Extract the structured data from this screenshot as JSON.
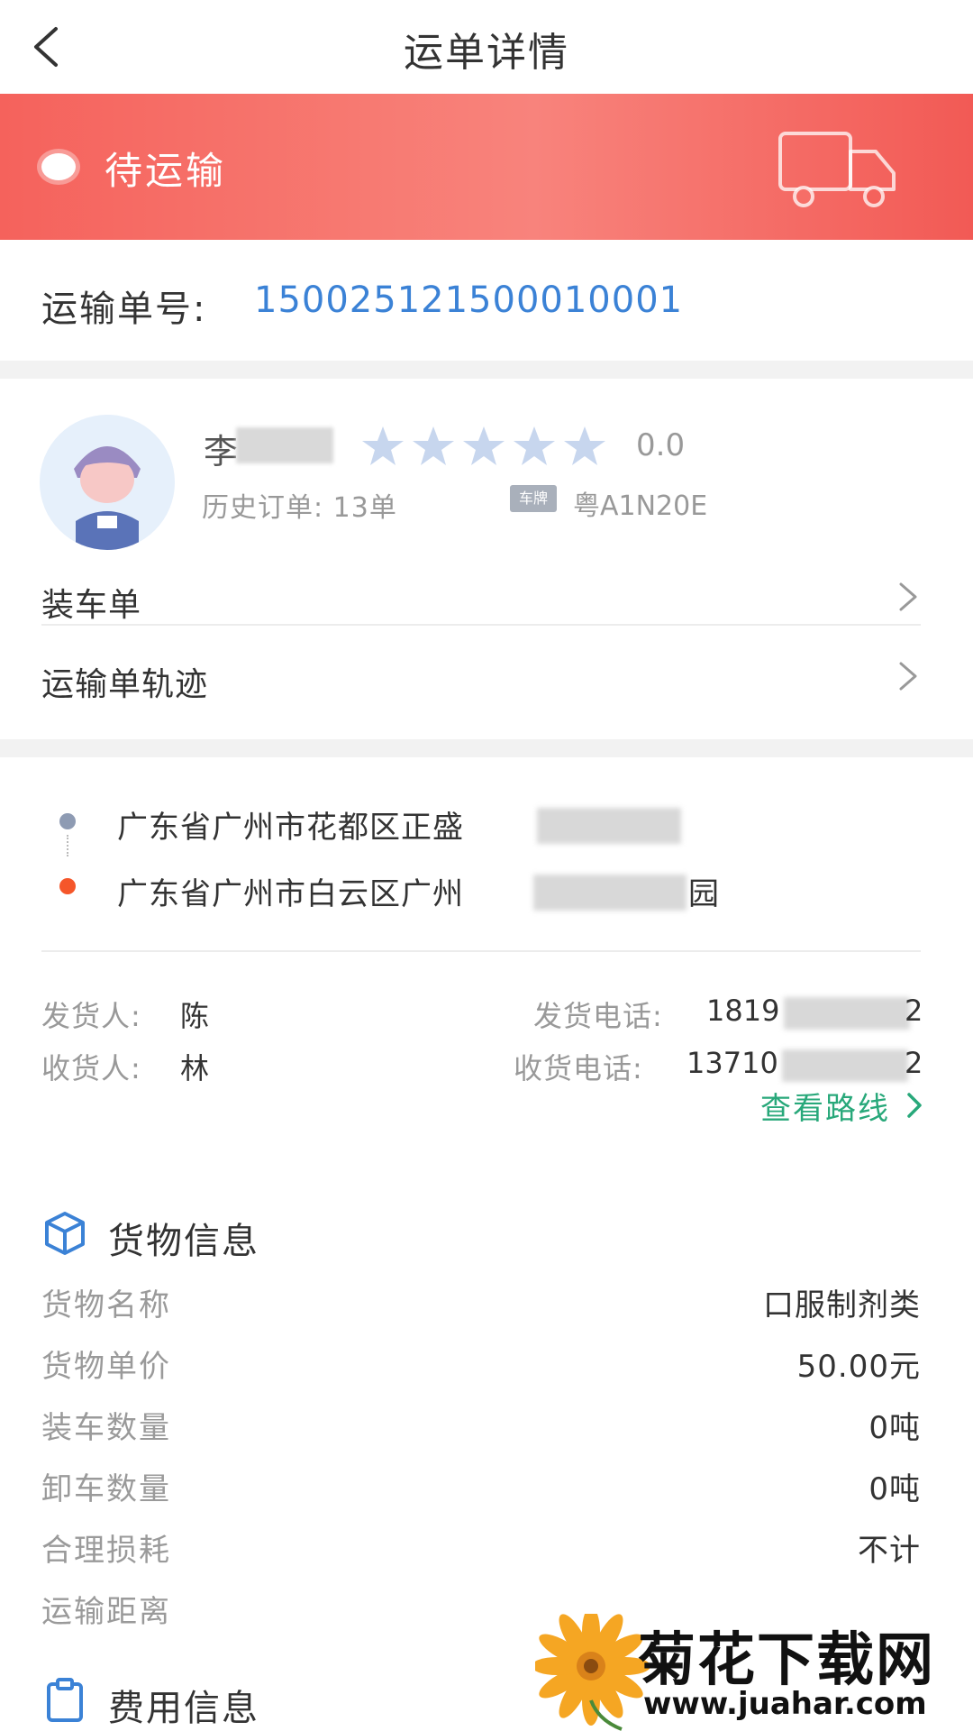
{
  "header": {
    "back_icon": "chevron-left-icon",
    "title": "运单详情"
  },
  "status": {
    "label": "待运输",
    "icon": "truck-icon",
    "gradient": [
      "#f5625c",
      "#f8837c",
      "#f25a55"
    ]
  },
  "waybill": {
    "label": "运输单号:",
    "number": "150025121500010001"
  },
  "driver": {
    "name_first": "李",
    "rating_stars": 0,
    "rating_max": 5,
    "rating_text": "0.0",
    "history_orders": "历史订单: 13单",
    "plate_tag": "车牌",
    "plate_number": "粤A1N20E"
  },
  "menu": {
    "items": [
      {
        "label": "装车单"
      },
      {
        "label": "运输单轨迹"
      }
    ]
  },
  "route": {
    "from_address": "广东省广州市花都区正盛",
    "to_address": "广东省广州市白云区广州",
    "to_suffix": "园",
    "shipper_label": "发货人:",
    "shipper_name": "陈",
    "shipper_phone_label": "发货电话:",
    "shipper_phone_head": "1819",
    "shipper_phone_tail": "2",
    "receiver_label": "收货人:",
    "receiver_name": "林",
    "receiver_phone_label": "收货电话:",
    "receiver_phone_head": "13710",
    "receiver_phone_tail": "2",
    "view_route": "查看路线"
  },
  "cargo": {
    "title": "货物信息",
    "rows": [
      {
        "label": "货物名称",
        "value": "口服制剂类"
      },
      {
        "label": "货物单价",
        "value": "50.00元"
      },
      {
        "label": "装车数量",
        "value": "0吨"
      },
      {
        "label": "卸车数量",
        "value": "0吨"
      },
      {
        "label": "合理损耗",
        "value": "不计"
      },
      {
        "label": "运输距离",
        "value": ""
      }
    ]
  },
  "fee": {
    "title": "费用信息"
  },
  "watermark": {
    "title": "菊花下载网",
    "url": "www.juahar.com"
  },
  "colors": {
    "accent_blue": "#3b82d6",
    "route_green": "#28a87a",
    "start_dot": "#8e9bb3",
    "end_dot": "#f5562a",
    "star": "#c7d6ee"
  }
}
